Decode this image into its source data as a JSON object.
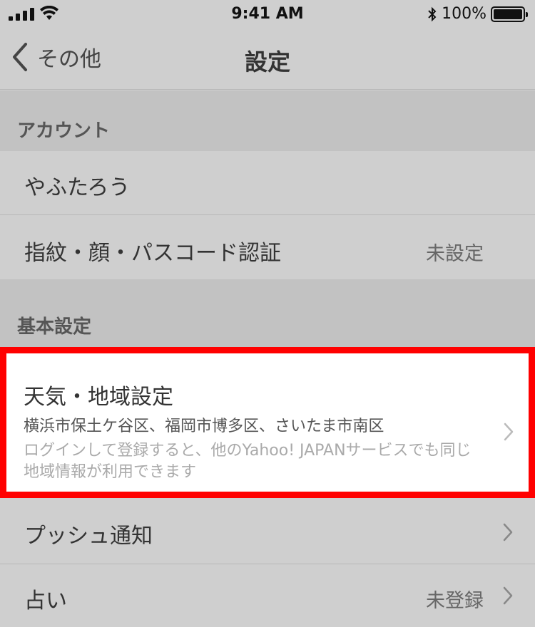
{
  "status_bar": {
    "time": "9:41 AM",
    "battery": "100%",
    "icons": [
      "signal-icon",
      "wifi-icon",
      "bluetooth-icon",
      "battery-icon"
    ]
  },
  "nav": {
    "back_label": "その他",
    "title": "設定"
  },
  "sections": {
    "account": {
      "header": "アカウント"
    },
    "basic": {
      "header": "基本設定"
    }
  },
  "account": {
    "username": "やふたろう",
    "auth_label": "指紋・顔・パスコード認証",
    "auth_value": "未設定"
  },
  "weather_region": {
    "title": "天気・地域設定",
    "regions": "横浜市保土ケ谷区、福岡市博多区、さいたま市南区",
    "note": "ログインして登録すると、他のYahoo! JAPANサービスでも同じ地域情報が利用できます"
  },
  "push": {
    "label": "プッシュ通知"
  },
  "fortune": {
    "label": "占い",
    "value": "未登録"
  },
  "colors": {
    "background": "#cfcfcf",
    "section_header": "#c2c2c2",
    "highlight_border": "#ff0000"
  }
}
